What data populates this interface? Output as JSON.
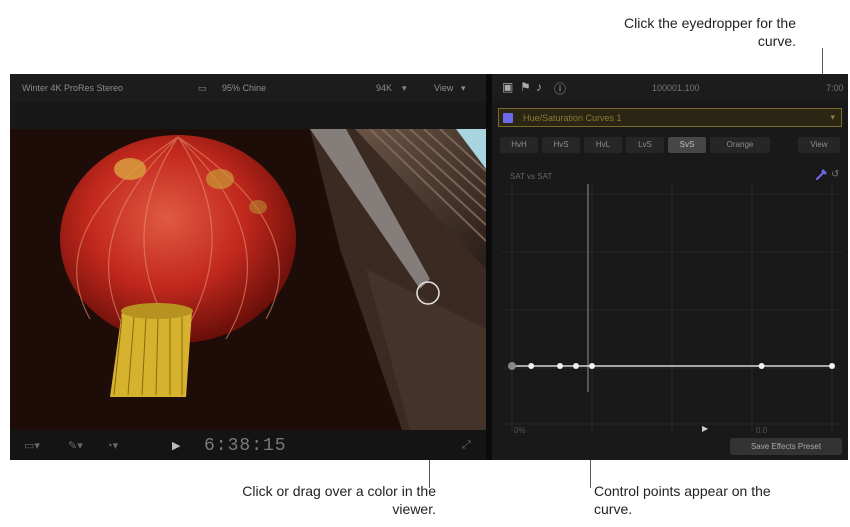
{
  "callouts": {
    "eyedropper": "Click the eyedropper for the curve.",
    "viewer": "Click or drag over a color in the viewer.",
    "control_points": "Control points appear on the curve."
  },
  "viewer": {
    "library": "Winter 4K ProRes Stereo",
    "clip": "95% Chine",
    "format_menu": "94K",
    "view_menu": "View",
    "timecode": "6:38:15"
  },
  "inspector": {
    "title": "100001.100",
    "duration": "7:00",
    "effect_name": "Hue/Saturation Curves 1",
    "curve_tabs": [
      "HvH",
      "HvS",
      "HvL",
      "LvS",
      "SvS",
      "Orange"
    ],
    "active_tab": "SvS",
    "view_button": "View",
    "curve_label": "SAT vs SAT",
    "range_left": "0%",
    "range_right": "0.0",
    "save_preset": "Save Effects Preset"
  },
  "curve": {
    "x": [
      0,
      0.06,
      0.15,
      0.2,
      0.25,
      0.78,
      1.0
    ],
    "y": [
      0.5,
      0.5,
      0.5,
      0.5,
      0.5,
      0.5,
      0.5
    ]
  },
  "colors": {
    "accent": "#6c6ae8",
    "effect_border": "#7a6a2c",
    "curve_line": "#d8d8d8"
  }
}
